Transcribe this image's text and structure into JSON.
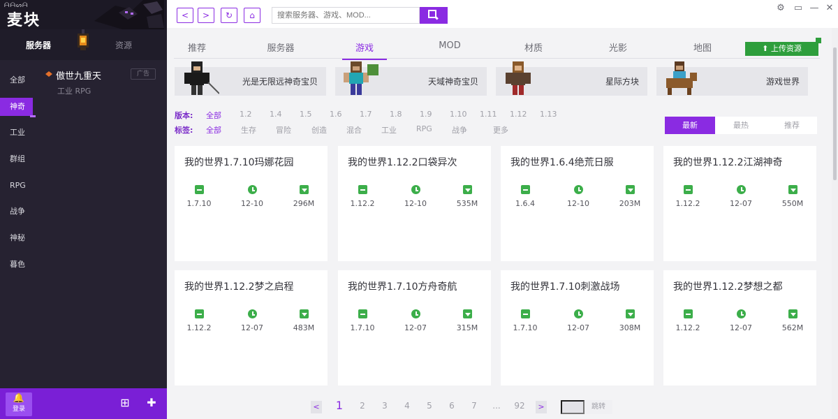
{
  "app": {
    "logo_small": "ᗩᗩᔕᗩ",
    "logo_text": "麦块"
  },
  "sidebar": {
    "tabs": [
      {
        "label": "服务器",
        "active": true
      },
      {
        "label": "资源",
        "active": false
      }
    ],
    "categories": [
      {
        "label": "全部",
        "active": false
      },
      {
        "label": "神奇",
        "active": true
      },
      {
        "label": "工业",
        "active": false
      },
      {
        "label": "群组",
        "active": false
      },
      {
        "label": "RPG",
        "active": false
      },
      {
        "label": "战争",
        "active": false
      },
      {
        "label": "神秘",
        "active": false
      },
      {
        "label": "暮色",
        "active": false
      }
    ],
    "server": {
      "name": "傲世九重天",
      "tags": "工业 RPG",
      "badge": "广告"
    },
    "login_label": "登录"
  },
  "toolbar": {
    "search_placeholder": "搜索服务器、游戏、MOD..."
  },
  "tabs": [
    {
      "label": "推荐",
      "active": false
    },
    {
      "label": "服务器",
      "active": false
    },
    {
      "label": "游戏",
      "active": true
    },
    {
      "label": "MOD",
      "active": false
    },
    {
      "label": "材质",
      "active": false
    },
    {
      "label": "光影",
      "active": false
    },
    {
      "label": "地图",
      "active": false
    }
  ],
  "upload_label": "上传资源",
  "featured": [
    {
      "label": "光是无限远神奇宝贝"
    },
    {
      "label": "天域神奇宝贝"
    },
    {
      "label": "星际方块"
    },
    {
      "label": "游戏世界"
    }
  ],
  "filters": {
    "version_key": "版本:",
    "versions": [
      "全部",
      "1.2",
      "1.4",
      "1.5",
      "1.6",
      "1.7",
      "1.8",
      "1.9",
      "1.10",
      "1.11",
      "1.12",
      "1.13"
    ],
    "tag_key": "标签:",
    "tags": [
      "全部",
      "生存",
      "冒险",
      "创造",
      "混合",
      "工业",
      "RPG",
      "战争",
      "更多"
    ]
  },
  "sort": [
    {
      "label": "最新",
      "active": true
    },
    {
      "label": "最热",
      "active": false
    },
    {
      "label": "推荐",
      "active": false
    }
  ],
  "cards": [
    {
      "title": "我的世界1.7.10玛娜花园",
      "version": "1.7.10",
      "date": "12-10",
      "size": "296M"
    },
    {
      "title": "我的世界1.12.2口袋异次",
      "version": "1.12.2",
      "date": "12-10",
      "size": "535M"
    },
    {
      "title": "我的世界1.6.4绝荒日服",
      "version": "1.6.4",
      "date": "12-10",
      "size": "203M"
    },
    {
      "title": "我的世界1.12.2江湖神奇",
      "version": "1.12.2",
      "date": "12-07",
      "size": "550M"
    },
    {
      "title": "我的世界1.12.2梦之启程",
      "version": "1.12.2",
      "date": "12-07",
      "size": "483M"
    },
    {
      "title": "我的世界1.7.10方舟奇航",
      "version": "1.7.10",
      "date": "12-07",
      "size": "315M"
    },
    {
      "title": "我的世界1.7.10刺激战场",
      "version": "1.7.10",
      "date": "12-07",
      "size": "308M"
    },
    {
      "title": "我的世界1.12.2梦想之都",
      "version": "1.12.2",
      "date": "12-07",
      "size": "562M"
    }
  ],
  "pagination": {
    "prev": "<",
    "pages": [
      "1",
      "2",
      "3",
      "4",
      "5",
      "6",
      "7",
      "...",
      "92"
    ],
    "next": ">",
    "jump_label": "跳转"
  },
  "colors": {
    "accent": "#8a2be2",
    "sidebar_bg": "#262231",
    "green": "#3cae4a"
  }
}
